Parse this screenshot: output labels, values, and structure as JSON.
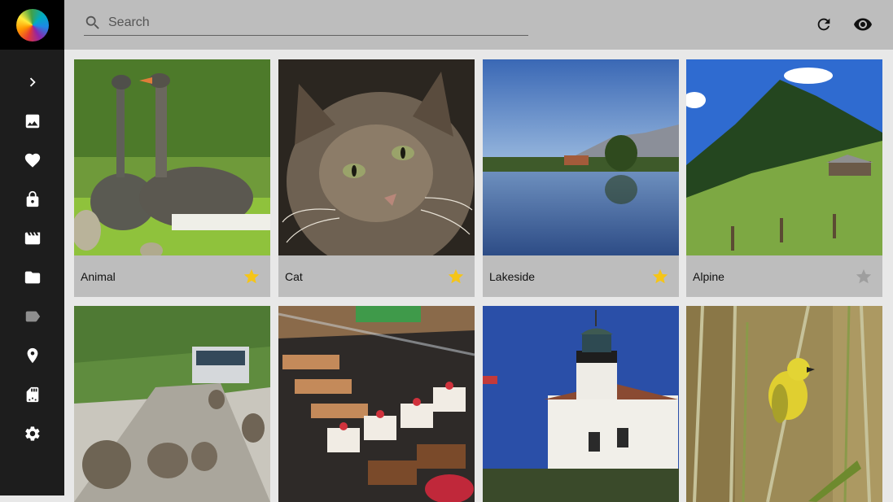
{
  "search": {
    "placeholder": "Search"
  },
  "sidebar": {
    "items": [
      {
        "icon": "chevron-right-icon"
      },
      {
        "icon": "image-icon"
      },
      {
        "icon": "heart-icon"
      },
      {
        "icon": "lock-icon"
      },
      {
        "icon": "movie-icon"
      },
      {
        "icon": "folder-icon"
      },
      {
        "icon": "label-icon"
      },
      {
        "icon": "place-icon"
      },
      {
        "icon": "sd-card-icon"
      },
      {
        "icon": "settings-icon"
      }
    ]
  },
  "toolbar": {
    "refresh_icon": "refresh-icon",
    "view_icon": "eye-icon"
  },
  "photos": [
    {
      "title": "Animal",
      "favorite": true
    },
    {
      "title": "Cat",
      "favorite": true
    },
    {
      "title": "Lakeside",
      "favorite": true
    },
    {
      "title": "Alpine",
      "favorite": false
    },
    {
      "title": "",
      "favorite": null
    },
    {
      "title": "",
      "favorite": null
    },
    {
      "title": "",
      "favorite": null
    },
    {
      "title": "",
      "favorite": null
    }
  ],
  "colors": {
    "star_on": "#f5c518",
    "star_off": "#9e9e9e",
    "sidebar": "#1d1d1d",
    "topbar": "#bdbdbd"
  }
}
